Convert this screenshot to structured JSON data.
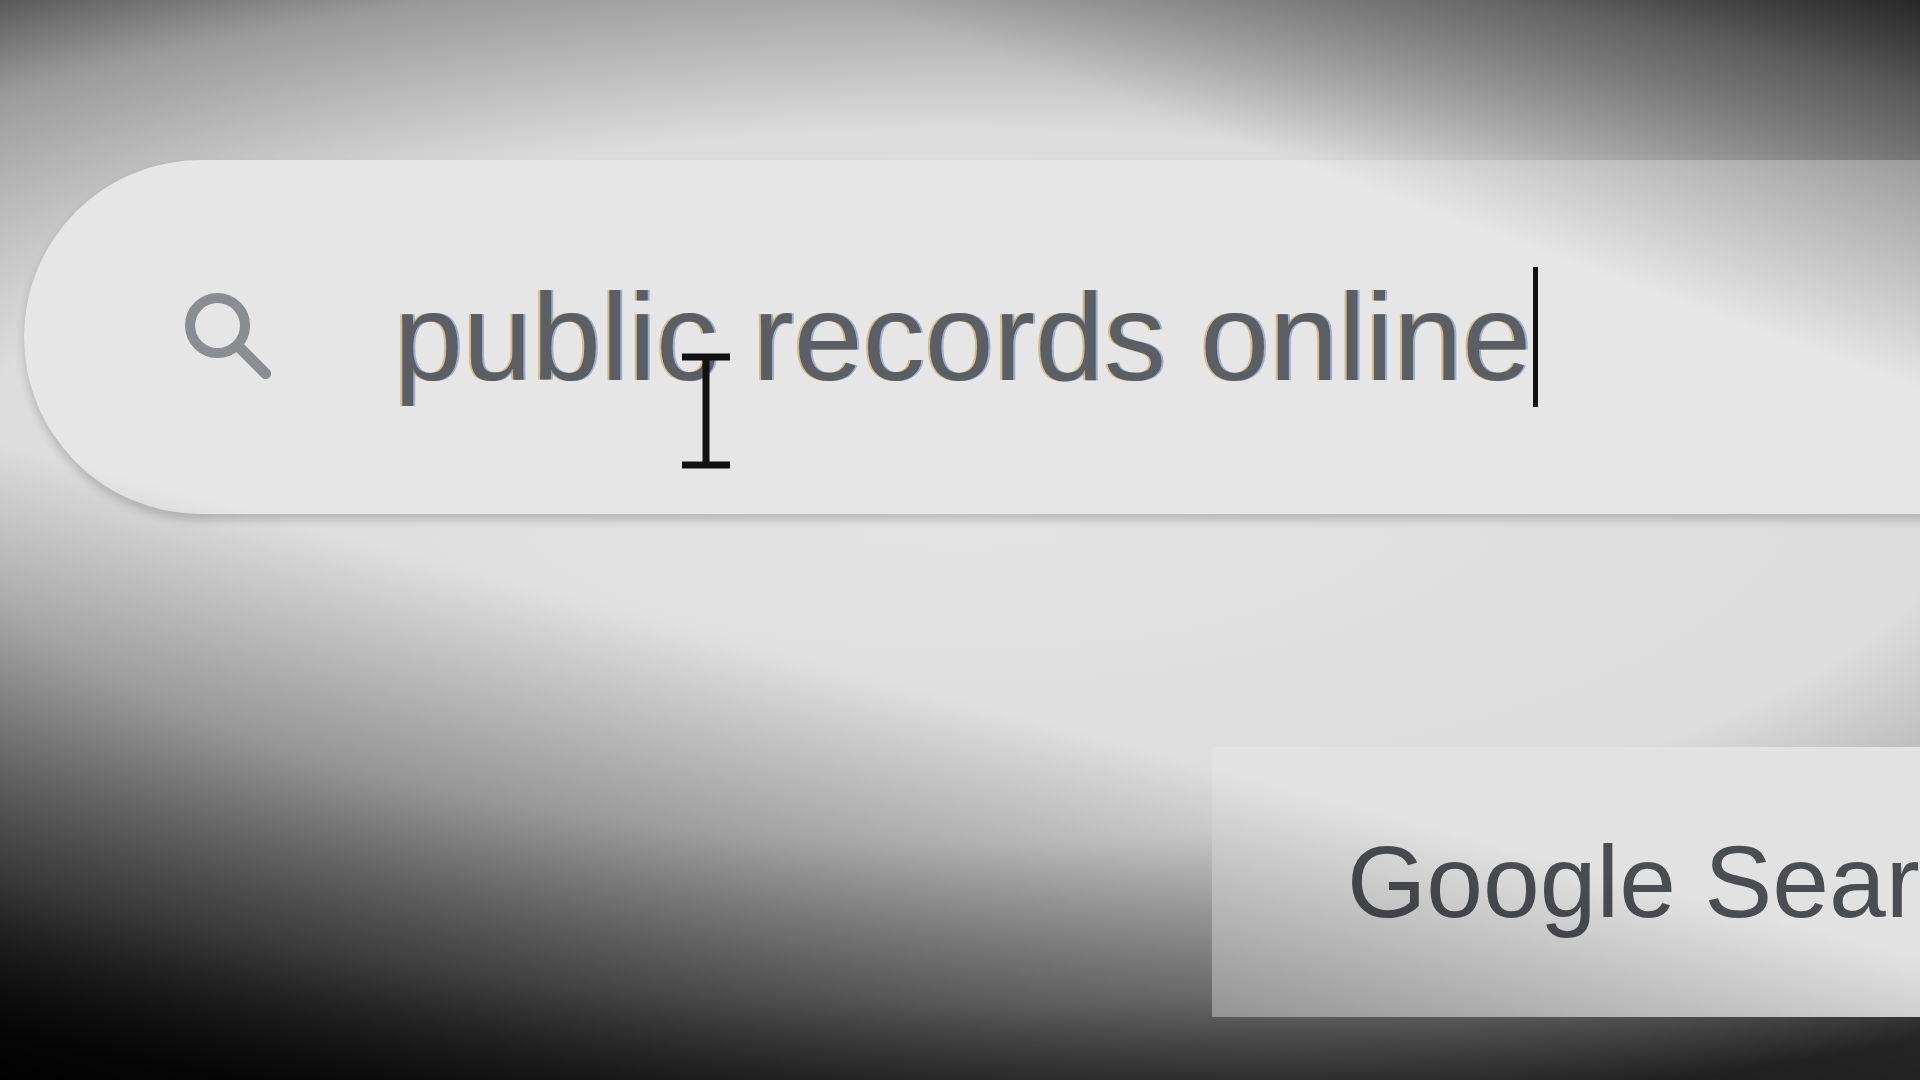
{
  "search": {
    "value": "public records online",
    "focused": true
  },
  "buttons": [
    {
      "label": "Google Sear"
    }
  ]
}
